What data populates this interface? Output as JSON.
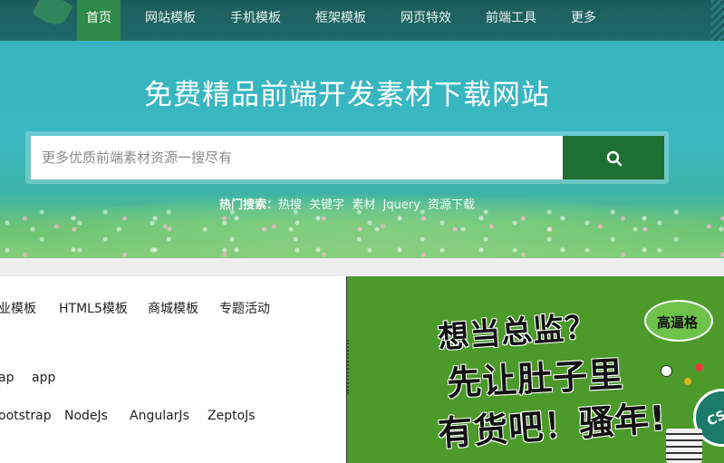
{
  "nav": {
    "items": [
      {
        "label": "首页",
        "active": true
      },
      {
        "label": "网站模板"
      },
      {
        "label": "手机模板"
      },
      {
        "label": "框架模板"
      },
      {
        "label": "网页特效"
      },
      {
        "label": "前端工具"
      },
      {
        "label": "更多"
      }
    ]
  },
  "hero": {
    "title": "免费精品前端开发素材下载网站",
    "search": {
      "placeholder": "更多优质前端素材资源一搜尽有",
      "button_icon": "search-icon"
    },
    "hot": {
      "label": "热门搜索：",
      "tags": [
        "热搜",
        "关键字",
        "素材",
        "Jquery",
        "资源下载"
      ]
    }
  },
  "links": {
    "row1": [
      "业模板",
      "HTML5模板",
      "商城模板",
      "专题活动"
    ],
    "row2": [
      "ap",
      "app"
    ],
    "row3": [
      "ootstrap",
      "NodeJs",
      "AngularJs",
      "ZeptoJs"
    ]
  },
  "ad": {
    "line1": "想当总监？",
    "line2": "先让肚子里",
    "line3": "有货吧！骚年!",
    "badge": "高逼格",
    "ball": "CSS"
  },
  "colors": {
    "nav_bg": "#1d5c5c",
    "nav_active": "#2e8a4a",
    "search_button": "#1e6f33",
    "ad_bg": "#4b9a2a"
  }
}
